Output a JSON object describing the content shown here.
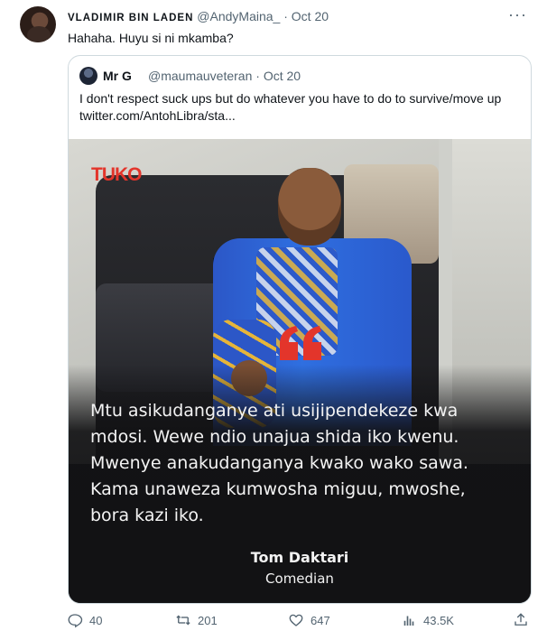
{
  "tweet": {
    "author_name": "VLADIMIR BIN LADEN",
    "handle": "@AndyMaina_",
    "separator": "·",
    "date": "Oct 20",
    "more": "···",
    "text": "Hahaha. Huyu si ni mkamba?"
  },
  "quote": {
    "author_name": "Mr G",
    "handle": "@maumauveteran",
    "separator": "·",
    "date": "Oct 20",
    "text": "I don't respect suck ups but do whatever you have to do to survive/move up  twitter.com/AntohLibra/sta..."
  },
  "media": {
    "logo": "TUKO",
    "quote_lines": [
      "Mtu asikudanganye ati usijipendekeze kwa",
      "mdosi. Wewe ndio unajua shida iko kwenu.",
      "Mwenye anakudanganya kwako wako sawa.",
      "Kama unaweza kumwosha miguu, mwoshe,",
      "bora kazi iko."
    ],
    "author_name": "Tom Daktari",
    "author_role": "Comedian"
  },
  "actions": {
    "replies": "40",
    "retweets": "201",
    "likes": "647",
    "views": "43.5K"
  },
  "colors": {
    "text_primary": "#0f1419",
    "text_secondary": "#536471",
    "border": "#cfd9de",
    "tuko_red": "#e3352b"
  },
  "icons": [
    "reply-icon",
    "retweet-icon",
    "like-icon",
    "views-icon",
    "share-icon",
    "more-icon"
  ]
}
